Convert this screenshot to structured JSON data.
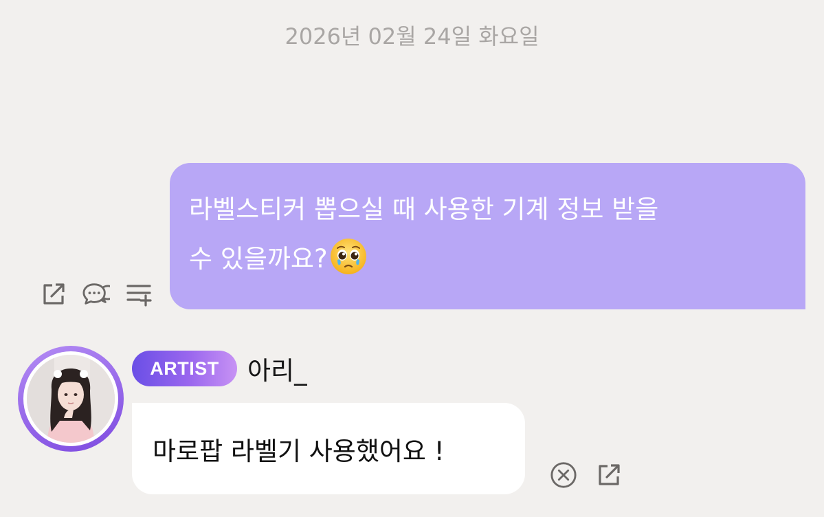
{
  "date_header": "2026년 02월 24일 화요일",
  "sent_message": {
    "text_line1": "라벨스티커 뽑으실 때 사용한 기계 정보 받을",
    "text_line2": "수 있을까요?",
    "emoji": "pleading-face-emoji",
    "color": "#b8a7f6"
  },
  "sent_actions": {
    "icons": [
      "share-icon",
      "comment-icon",
      "add-to-list-icon"
    ]
  },
  "artist": {
    "badge": "ARTIST",
    "name": "아리_",
    "badge_colors": [
      "#6a4fe6",
      "#c792f4"
    ]
  },
  "received_message": {
    "text": "마로팝 라벨기 사용했어요 !"
  },
  "recv_actions": {
    "icons": [
      "close-circle-icon",
      "share-icon"
    ]
  }
}
